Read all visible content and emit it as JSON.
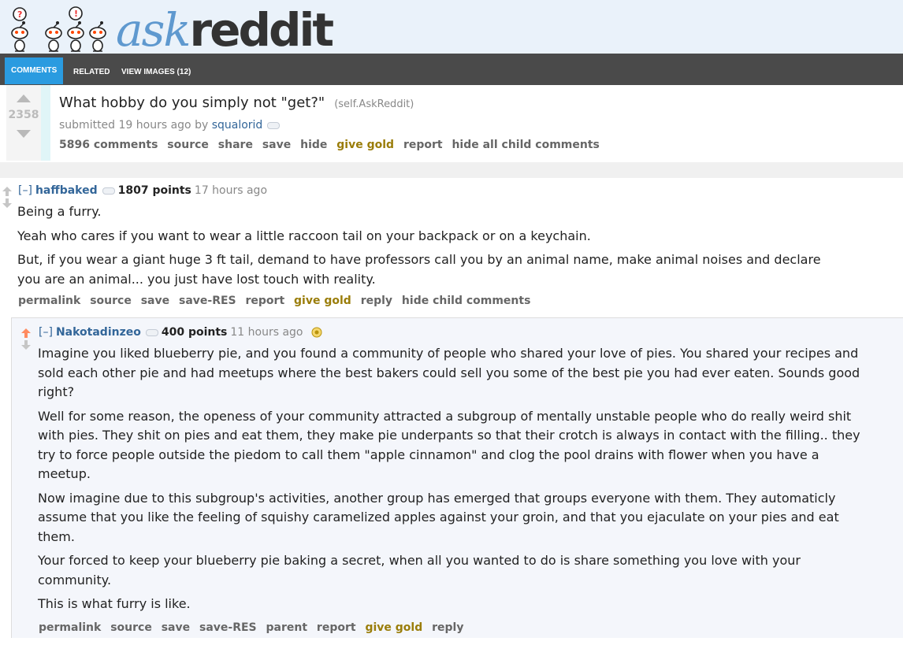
{
  "header": {
    "logo_prefix": "ask",
    "logo_suffix": "reddit",
    "tabs": [
      {
        "label": "COMMENTS",
        "active": true
      },
      {
        "label": "RELATED",
        "active": false
      },
      {
        "label": "VIEW IMAGES (12)",
        "active": false
      }
    ]
  },
  "post": {
    "score": "2358",
    "title": "What hobby do you simply not \"get?\"",
    "domain": "(self.AskReddit)",
    "submitted_text": "submitted 19 hours ago by",
    "author": "squalorid",
    "actions": [
      "5896 comments",
      "source",
      "share",
      "save",
      "hide",
      "give gold",
      "report",
      "hide all child comments"
    ]
  },
  "comments": [
    {
      "collapse": "[–]",
      "author": "haffbaked",
      "points": "1807 points",
      "age": "17 hours ago",
      "paragraphs": [
        "Being a furry.",
        "Yeah who cares if you want to wear a little raccoon tail on your backpack or on a keychain.",
        "But, if you wear a giant huge 3 ft tail, demand to have professors call you by an animal name, make animal noises and declare you are an animal... you just have lost touch with reality."
      ],
      "actions": [
        "permalink",
        "source",
        "save",
        "save-RES",
        "report",
        "give gold",
        "reply",
        "hide child comments"
      ]
    },
    {
      "collapse": "[–]",
      "author": "Nakotadinzeo",
      "points": "400 points",
      "age": "11 hours ago",
      "paragraphs": [
        "Imagine you liked blueberry pie, and you found a community of people who shared your love of pies. You shared your recipes and sold each other pie and had meetups where the best bakers could sell you some of the best pie you had ever eaten. Sounds good right?",
        "Well for some reason, the openess of your community attracted a subgroup of mentally unstable people who do really weird shit with pies. They shit on pies and eat them, they make pie underpants so that their crotch is always in contact with the filling.. they try to force people outside the piedom to call them \"apple cinnamon\" and clog the pool drains with flower when you have a meetup.",
        "Now imagine due to this subgroup's activities, another group has emerged that groups everyone with them. They automaticly assume that you like the feeling of squishy caramelized apples against your groin, and that you ejaculate on your pies and eat them.",
        "Your forced to keep your blueberry pie baking a secret, when all you wanted to do is share something you love with your community.",
        "This is what furry is like."
      ],
      "actions": [
        "permalink",
        "source",
        "save",
        "save-RES",
        "parent",
        "report",
        "give gold",
        "reply"
      ]
    }
  ],
  "colors": {
    "accent_tab": "#2a9be0",
    "tabbar": "#4a4a4a",
    "link": "#336699",
    "gold": "#9a7d0a",
    "upvote": "#ff8b60"
  }
}
